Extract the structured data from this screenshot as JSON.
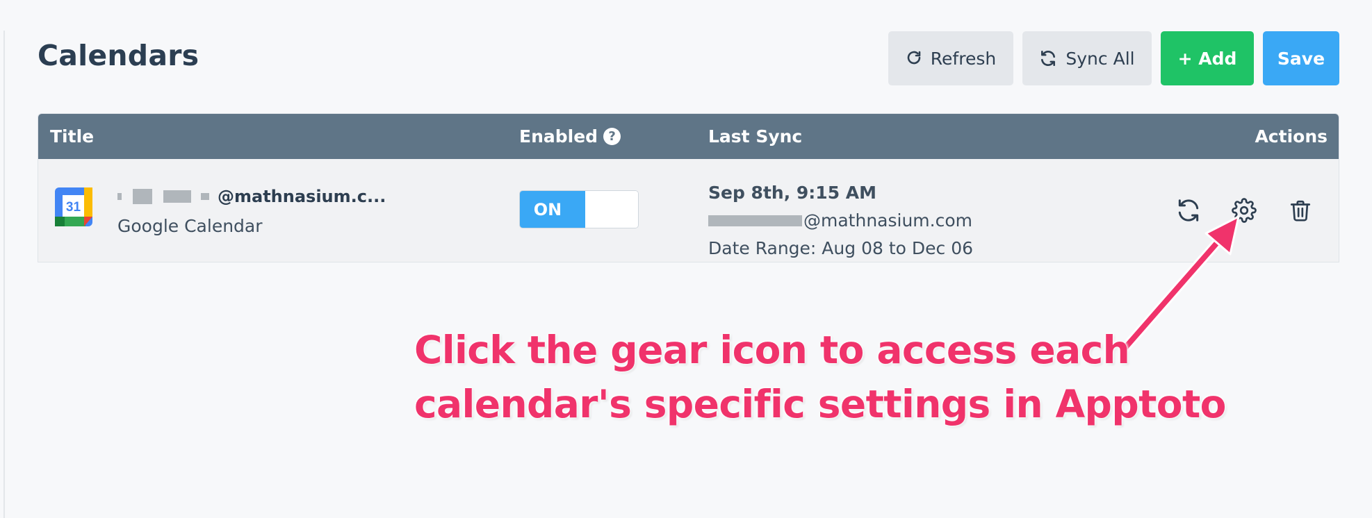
{
  "header": {
    "title": "Calendars",
    "buttons": {
      "refresh_label": "Refresh",
      "sync_all_label": "Sync All",
      "add_label": "+ Add",
      "save_label": "Save"
    }
  },
  "table": {
    "columns": {
      "title": "Title",
      "enabled": "Enabled",
      "last_sync": "Last Sync",
      "actions": "Actions"
    },
    "rows": [
      {
        "calendar_name": "@mathnasium.c...",
        "calendar_type": "Google Calendar",
        "enabled_label": "ON",
        "enabled": true,
        "sync_date": "Sep 8th, 9:15 AM",
        "sync_email": "@mathnasium.com",
        "date_range": "Date Range: Aug 08 to Dec 06",
        "icon": "google-calendar-icon",
        "icon_text": "31"
      }
    ]
  },
  "annotation": {
    "line1": "Click the gear icon to access each",
    "line2": "calendar's specific settings in Apptoto"
  },
  "colors": {
    "header_bg": "#5f7587",
    "add_button": "#1fc366",
    "save_button": "#3aa8f5",
    "toggle_on": "#3aa8f5",
    "annotation": "#f0336b"
  }
}
